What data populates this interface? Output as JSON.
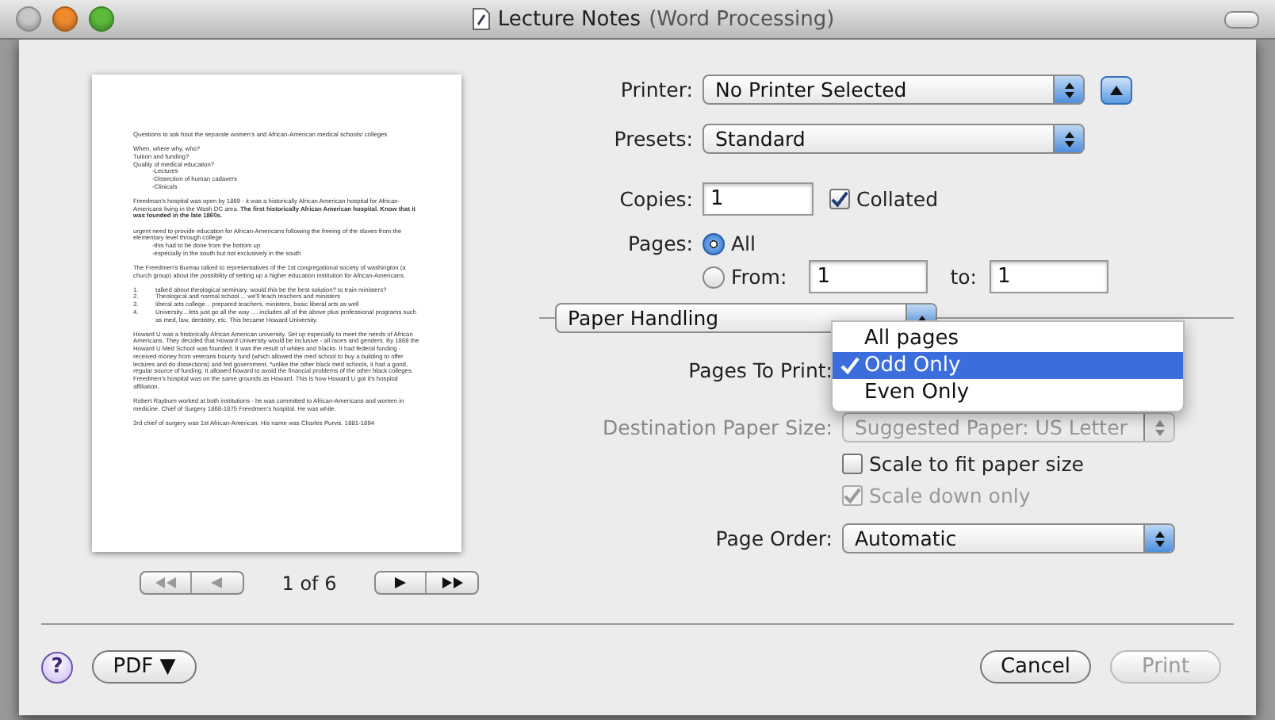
{
  "window": {
    "title": "Lecture Notes",
    "subtitle": "(Word Processing)"
  },
  "preview": {
    "blocks": [
      {
        "kind": "para",
        "text": "Questions to ask bout the separate women's and African-American medical schools/ colleges"
      },
      {
        "kind": "lines",
        "lines": [
          {
            "text": "When, where why, who?"
          },
          {
            "text": "Tuition and funding?"
          },
          {
            "text": "Quality of medical education?",
            "children": [
              {
                "text": "-Lectures"
              },
              {
                "text": "-Dissection of human cadavers"
              },
              {
                "text": "-Clinicals"
              }
            ]
          }
        ]
      },
      {
        "kind": "para",
        "text": "Freedman's hospital was open by 1869 - it was a historically African American hospital for African-Americans living in the Wash DC area. **The first historically African American hospital. Know that it was founded in the late 1860s.**"
      },
      {
        "kind": "lines",
        "lines": [
          {
            "text": "urgent need to provide education for African-Americans following the freeing of the slaves from the elementary level through college",
            "children": [
              {
                "text": "-this had to be done from the bottom up"
              },
              {
                "text": "-especially in the south but not exclusively in the south"
              }
            ]
          }
        ]
      },
      {
        "kind": "para",
        "text": "The Freedmen's Bureau talked to representatives of the 1st congregational society of washington (a church group) about the possibility of setting up a higher education institution for African-Americans."
      },
      {
        "kind": "list",
        "items": [
          {
            "number": "1.",
            "text": "talked about theological seminary. would this be the best solution? to train ministers?"
          },
          {
            "number": "2.",
            "text": "Theological and normal school.... we'll teach teachers and ministers"
          },
          {
            "number": "3.",
            "text": "liberal arts college... prepared teachers, ministers, basic liberal arts as well"
          },
          {
            "number": "4.",
            "text": "University... lets just go all the way .... includes all of the above plus professional programs such as med, law, dentistry, etc. This became Howard University."
          }
        ]
      },
      {
        "kind": "para",
        "text": "Howard U was a historically African American university. Set up especially to meet the needs of African Americans. They decided that Howard University would be inclusive - all races and genders. By 1868 the Howard U Med School was founded. It was the result of whites and blacks. It had federal funding - received money from veterans bounty fund (which allowed the med school to buy a building to offer lectures and do dissections) and fed government. *unlike the other black med schools, it had a good, regular source of funding. It allowed howard to avoid the financial problems of the other black colleges. Freedmen's hospital was on the same grounds as Howard. This is how Howard U got it's hospital affiliation."
      },
      {
        "kind": "para",
        "text": "Robert Rayburn worked at both institutions - he was committed to African-Americans and women in medicine. Chief of Surgery 1868-1875 Freedmen's hospital. He was white."
      },
      {
        "kind": "para",
        "text": "3rd chief of surgery was 1st African-American. His name was Charles Purvis. 1881-1894"
      }
    ]
  },
  "pager": {
    "label": "1 of 6",
    "back_disabled": true,
    "forward_disabled": false
  },
  "printer": {
    "label": "Printer:",
    "value": "No Printer Selected",
    "expanded": true
  },
  "presets": {
    "label": "Presets:",
    "value": "Standard"
  },
  "copies": {
    "label": "Copies:",
    "value": "1",
    "collated": {
      "label": "Collated",
      "checked": true
    }
  },
  "pages": {
    "label": "Pages:",
    "options": [
      {
        "label": "All",
        "selected": true
      },
      {
        "label": "From:",
        "selected": false
      }
    ],
    "from": "1",
    "to_label": "to:",
    "to": "1"
  },
  "section": {
    "value": "Paper Handling"
  },
  "pages_to_print": {
    "label": "Pages To Print:",
    "menu": [
      {
        "label": "All pages",
        "selected": false
      },
      {
        "label": "Odd Only",
        "selected": true
      },
      {
        "label": "Even Only",
        "selected": false
      }
    ]
  },
  "destination": {
    "label": "Destination Paper Size:",
    "value": "Suggested Paper: US Letter",
    "disabled": true
  },
  "scale_options": [
    {
      "label": "Scale to fit paper size",
      "checked": false,
      "disabled": false
    },
    {
      "label": "Scale down only",
      "checked": true,
      "disabled": true
    }
  ],
  "page_order": {
    "label": "Page Order:",
    "value": "Automatic"
  },
  "help": {
    "label": "?"
  },
  "pdf": {
    "label": "PDF ▼"
  },
  "buttons": [
    {
      "label": "Cancel",
      "disabled": false
    },
    {
      "label": "Print",
      "disabled": true
    }
  ]
}
